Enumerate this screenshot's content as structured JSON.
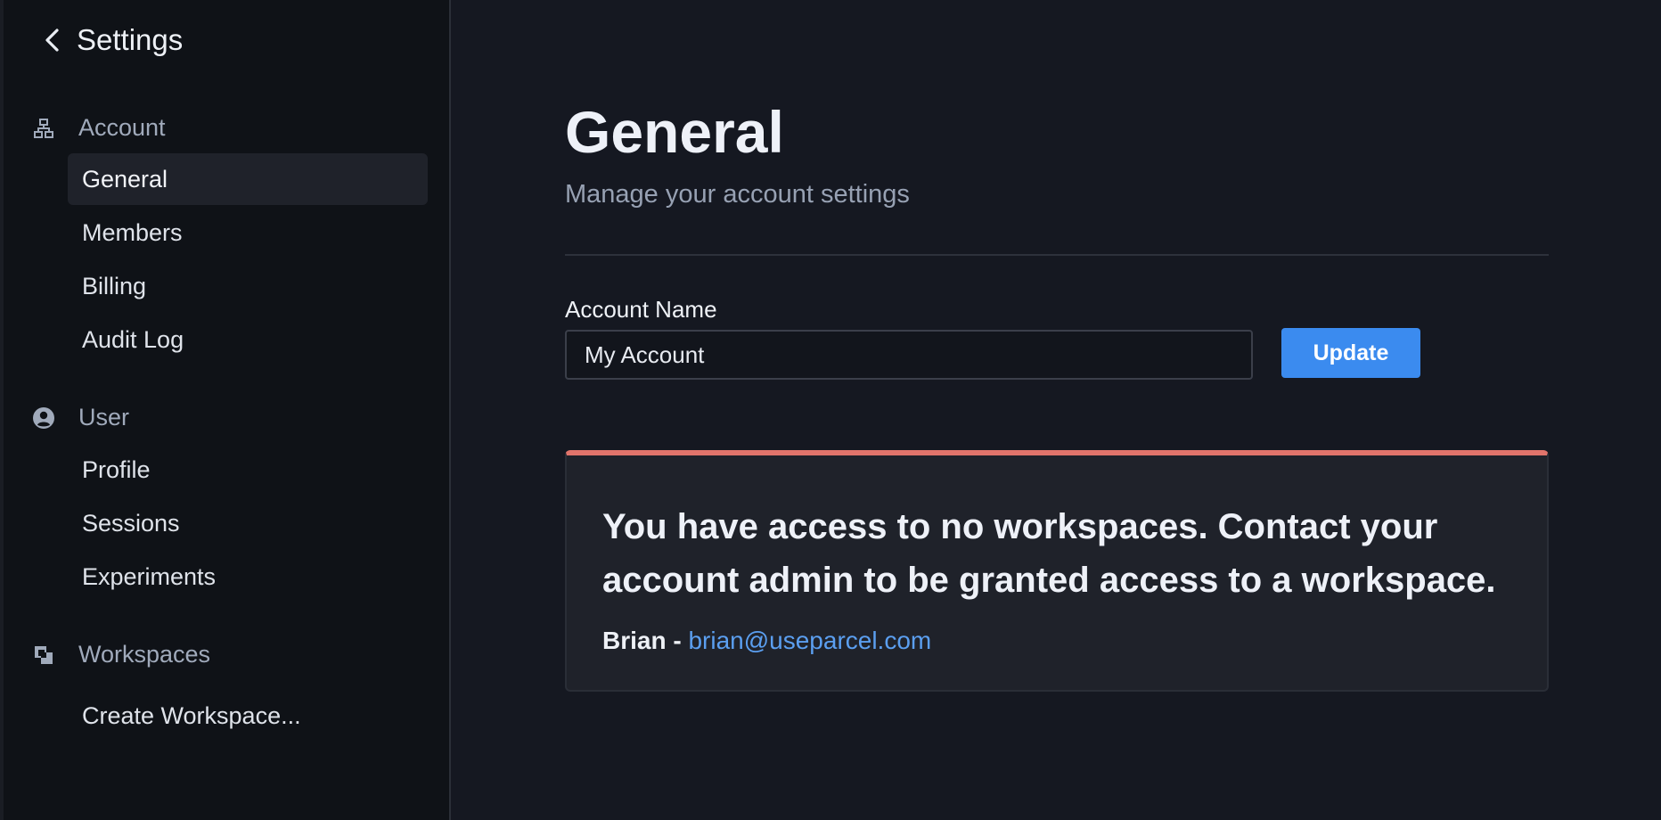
{
  "sidebar": {
    "back_label": "Settings",
    "groups": [
      {
        "label": "Account",
        "icon": "sitemap-icon",
        "items": [
          {
            "label": "General",
            "active": true
          },
          {
            "label": "Members",
            "active": false
          },
          {
            "label": "Billing",
            "active": false
          },
          {
            "label": "Audit Log",
            "active": false
          }
        ]
      },
      {
        "label": "User",
        "icon": "user-circle-icon",
        "items": [
          {
            "label": "Profile",
            "active": false
          },
          {
            "label": "Sessions",
            "active": false
          },
          {
            "label": "Experiments",
            "active": false
          }
        ]
      },
      {
        "label": "Workspaces",
        "icon": "workspaces-icon",
        "items": [
          {
            "label": "Create Workspace...",
            "active": false
          }
        ]
      }
    ]
  },
  "main": {
    "title": "General",
    "subtitle": "Manage your account settings",
    "account_name": {
      "label": "Account Name",
      "value": "My Account"
    },
    "update_label": "Update",
    "alert": {
      "message": "You have access to no workspaces. Contact your account admin to be granted access to a workspace.",
      "contact_name": "Brian - ",
      "contact_email": "brian@useparcel.com"
    }
  },
  "colors": {
    "accent": "#3b8bef",
    "alert_border": "#e1746b",
    "link": "#5b9ff0"
  }
}
